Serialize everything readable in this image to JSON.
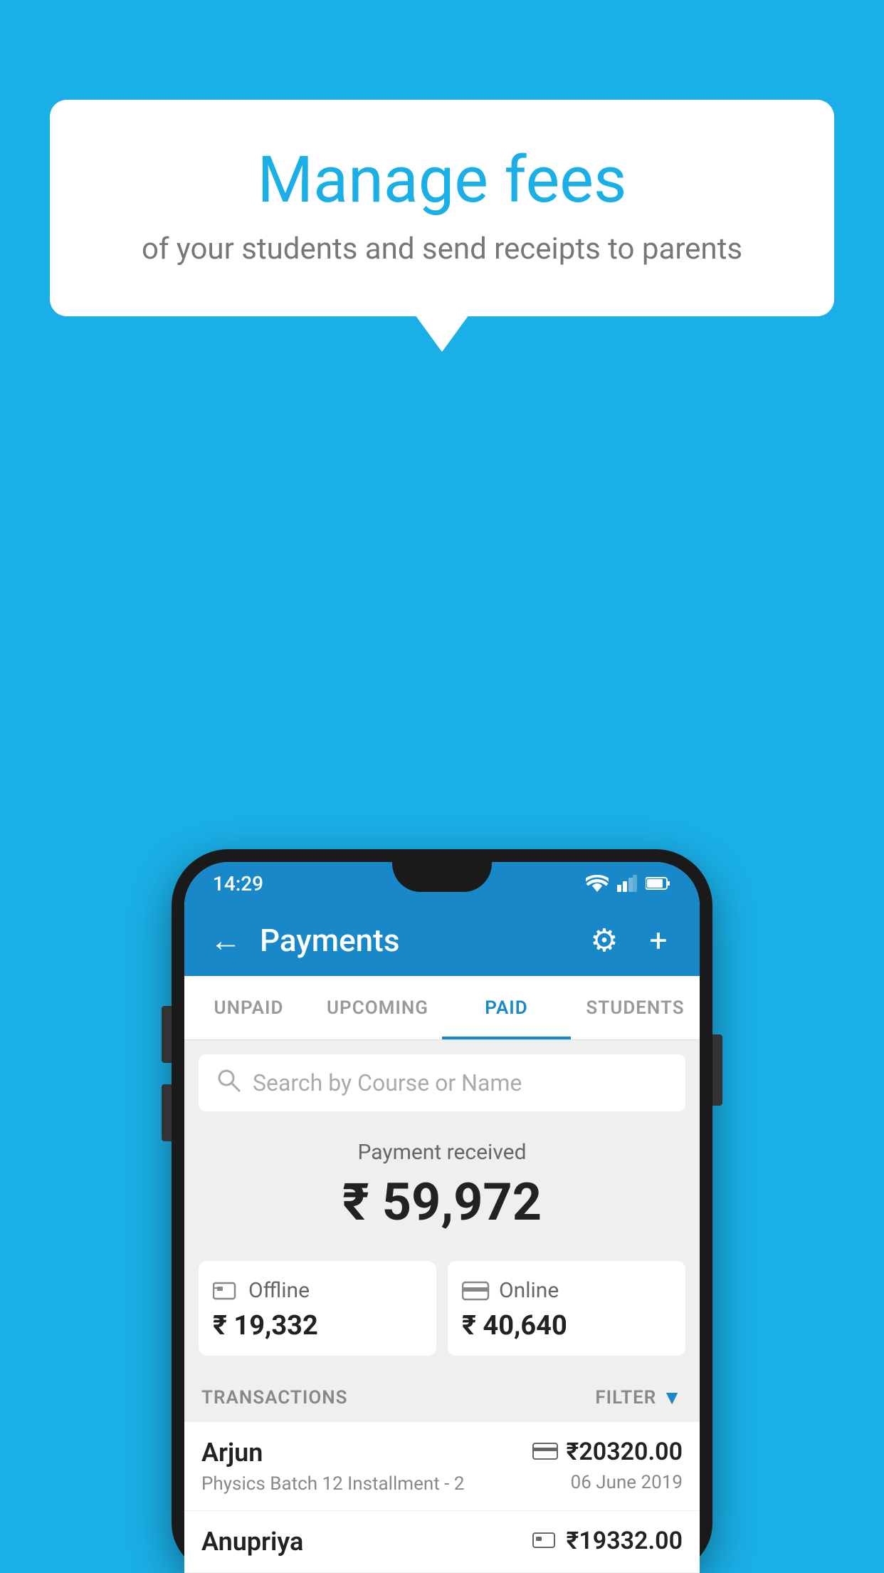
{
  "background_color": "#1AAFE6",
  "bubble": {
    "title": "Manage fees",
    "subtitle": "of your students and send receipts to parents"
  },
  "phone": {
    "status_bar": {
      "time": "14:29"
    },
    "app_bar": {
      "title": "Payments",
      "back_label": "←",
      "settings_label": "⚙",
      "add_label": "+"
    },
    "tabs": [
      {
        "label": "UNPAID",
        "active": false
      },
      {
        "label": "UPCOMING",
        "active": false
      },
      {
        "label": "PAID",
        "active": true
      },
      {
        "label": "STUDENTS",
        "active": false
      }
    ],
    "search": {
      "placeholder": "Search by Course or Name"
    },
    "payment_received": {
      "label": "Payment received",
      "amount": "₹ 59,972"
    },
    "offline_card": {
      "label": "Offline",
      "amount": "₹ 19,332"
    },
    "online_card": {
      "label": "Online",
      "amount": "₹ 40,640"
    },
    "transactions_label": "TRANSACTIONS",
    "filter_label": "FILTER",
    "transactions": [
      {
        "name": "Arjun",
        "desc": "Physics Batch 12 Installment - 2",
        "amount": "₹20320.00",
        "date": "06 June 2019",
        "type": "card"
      },
      {
        "name": "Anupriya",
        "desc": "",
        "amount": "₹19332.00",
        "date": "",
        "type": "offline"
      }
    ]
  }
}
